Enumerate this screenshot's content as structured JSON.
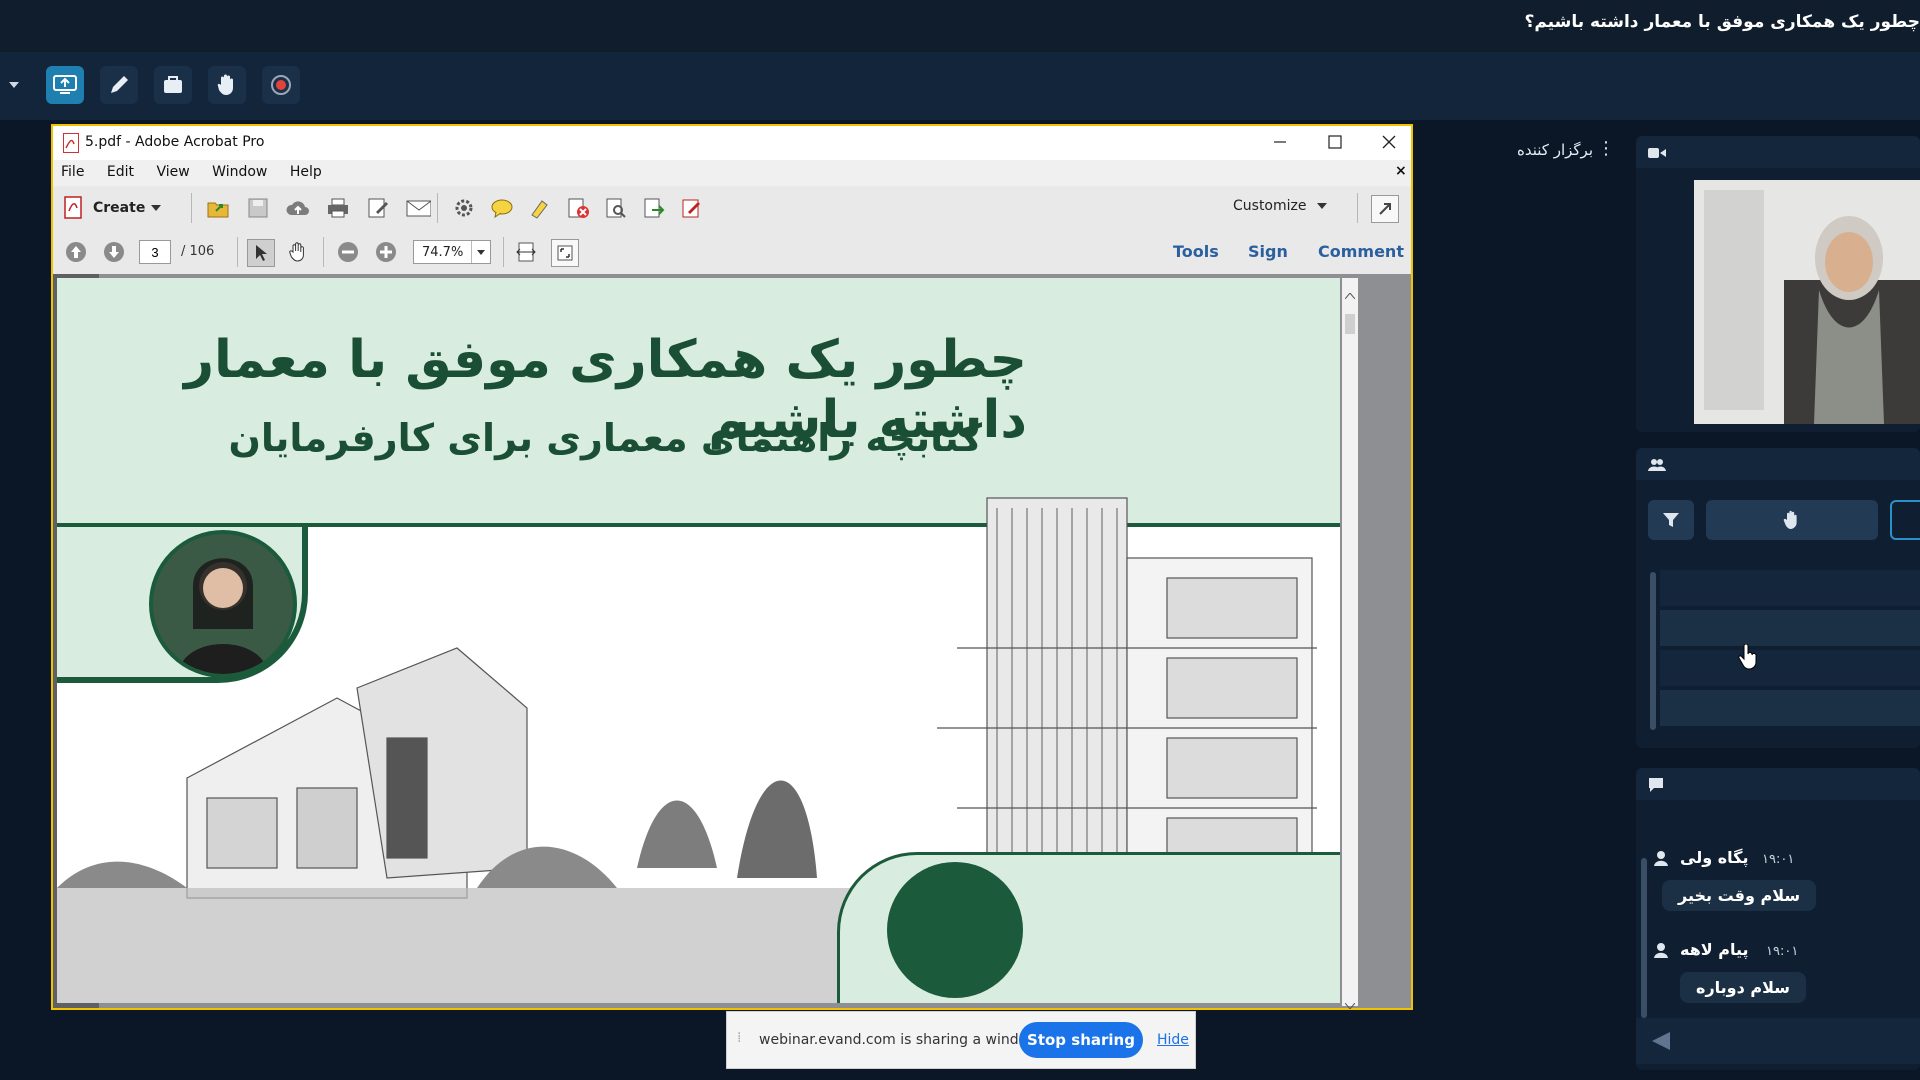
{
  "session": {
    "title": "چطور یک همکاری موفق با معمار داشته باشیم؟"
  },
  "panels": {
    "host_label": "برگزار کننده"
  },
  "acrobat": {
    "window_title": "5.pdf - Adobe Acrobat Pro",
    "menu": [
      "File",
      "Edit",
      "View",
      "Window",
      "Help"
    ],
    "create_label": "Create",
    "customize_label": "Customize",
    "current_page": "3",
    "total_pages": "/ 106",
    "zoom": "74.7%",
    "tools_label": "Tools",
    "sign_label": "Sign",
    "comment_label": "Comment"
  },
  "pdf": {
    "title": "چطور یک همکاری موفق با معمار داشته باشیم",
    "subtitle": "کتابچه راهنمای معماری برای کارفرمایان",
    "colors": {
      "band": "#d8ede0",
      "accent": "#1b5a3b"
    }
  },
  "share_bar": {
    "message": "webinar.evand.com is sharing a window.",
    "stop_label": "Stop sharing",
    "hide_label": "Hide"
  },
  "chat": {
    "messages": [
      {
        "name": "پگاه ولی",
        "time": "۱۹:۰۱",
        "text": "سلام وقت بخیر"
      },
      {
        "name": "پیام لاهه",
        "time": "۱۹:۰۱",
        "text": "سلام دوباره"
      }
    ]
  }
}
